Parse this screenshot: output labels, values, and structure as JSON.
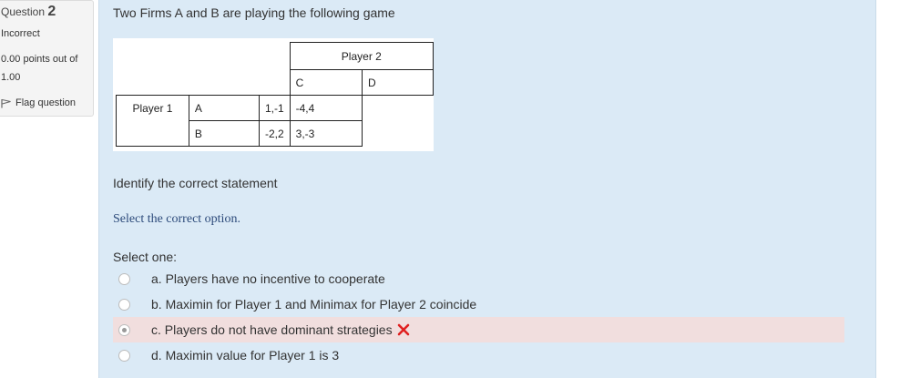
{
  "info": {
    "question_label": "Question",
    "question_number": "2",
    "state": "Incorrect",
    "grade_line1": "0.00 points out of",
    "grade_line2": "1.00",
    "flag_label": "Flag question"
  },
  "question": {
    "text": "Two Firms A and B are playing the following game",
    "table": {
      "player2_label": "Player 2",
      "player1_label": "Player 1",
      "col_strategies": [
        "C",
        "D"
      ],
      "row_strategies": [
        "A",
        "B"
      ],
      "payoffs": [
        [
          "1,-1",
          "-4,4"
        ],
        [
          "-2,2",
          "3,-3"
        ]
      ]
    },
    "prompt": "Identify the correct statement",
    "instruction": "Select the correct option.",
    "select_one": "Select one:",
    "options": [
      {
        "label": "a. Players have no incentive to cooperate",
        "selected": false
      },
      {
        "label": "b. Maximin for Player 1 and Minimax for Player 2 coincide",
        "selected": false
      },
      {
        "label": "c. Players do not have dominant strategies",
        "selected": true,
        "status": "incorrect"
      },
      {
        "label": "d. Maximin value for Player 1 is 3",
        "selected": false
      }
    ]
  },
  "colors": {
    "panel": "#dbeaf6",
    "wrong_highlight": "#f1dede",
    "incorrect_mark": "#e02020",
    "instruction_text": "#2c4a7a"
  }
}
